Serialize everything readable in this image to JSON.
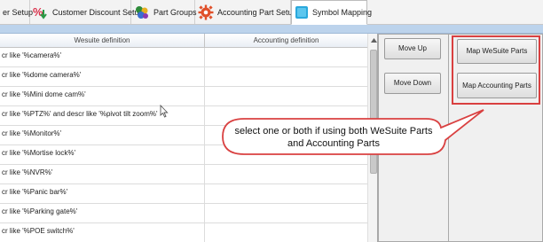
{
  "tabs": [
    {
      "label": "er Setup",
      "icon": "setup-icon"
    },
    {
      "label": "Customer Discount Setup",
      "icon": "percent-discount-icon"
    },
    {
      "label": "Part Groups",
      "icon": "part-groups-icon"
    },
    {
      "label": "Accounting Part Setup",
      "icon": "gear-icon"
    },
    {
      "label": "Symbol Mapping",
      "icon": "symbol-mapping-icon",
      "active": true
    }
  ],
  "grid": {
    "columns": [
      "Wesuite definition",
      "Accounting definition"
    ],
    "rows": [
      {
        "wesuite": "cr like '%camera%'",
        "accounting": ""
      },
      {
        "wesuite": "cr like '%dome camera%'",
        "accounting": ""
      },
      {
        "wesuite": "cr like '%Mini dome cam%'",
        "accounting": ""
      },
      {
        "wesuite": "cr like '%PTZ%' and descr like '%pivot tilt zoom%'",
        "accounting": ""
      },
      {
        "wesuite": "cr like '%Monitor%'",
        "accounting": ""
      },
      {
        "wesuite": "cr like '%Mortise lock%'",
        "accounting": ""
      },
      {
        "wesuite": "cr like '%NVR%'",
        "accounting": ""
      },
      {
        "wesuite": "cr like '%Panic bar%'",
        "accounting": ""
      },
      {
        "wesuite": "cr like '%Parking gate%'",
        "accounting": ""
      },
      {
        "wesuite": "cr like '%POE switch%'",
        "accounting": ""
      }
    ]
  },
  "buttons": {
    "move_up": "Move Up",
    "move_down": "Move Down",
    "map_wesuite": "Map WeSuite Parts",
    "map_accounting": "Map Accounting Parts"
  },
  "callout": {
    "text": "select one or both if using both WeSuite Parts and Accounting Parts"
  },
  "colors": {
    "highlight": "#d94040",
    "band": "#bcd3ec",
    "percent_icon": "#d9304a",
    "gear_icon": "#e0502a",
    "mapping_icon": "#2aa8dc"
  }
}
